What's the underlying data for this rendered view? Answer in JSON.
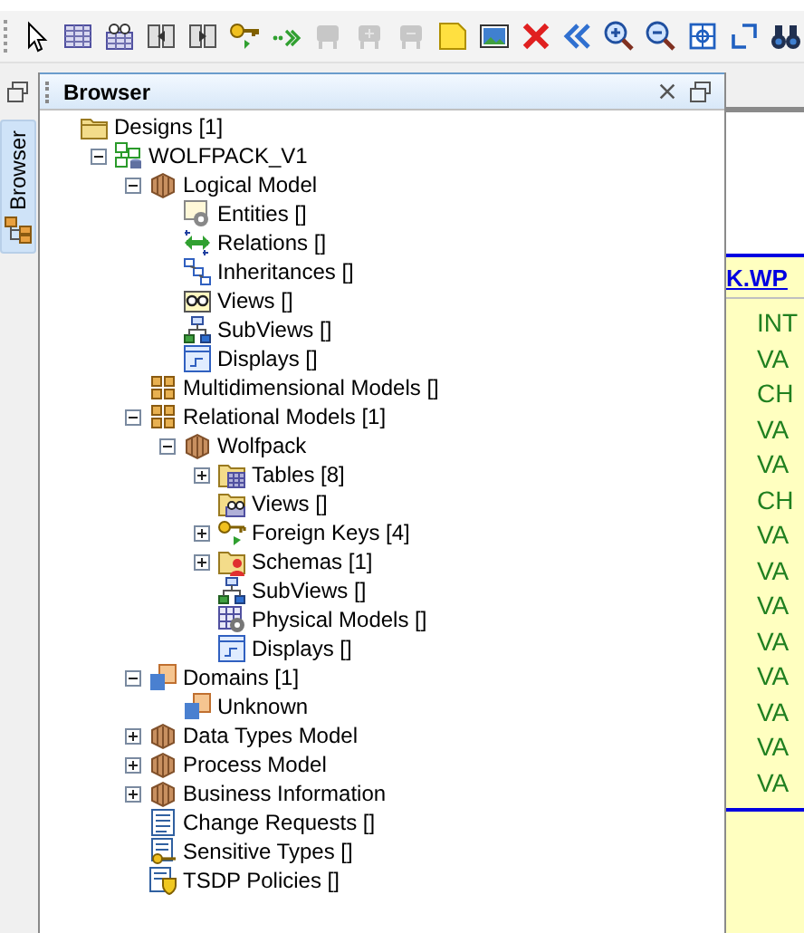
{
  "toolbar": [
    {
      "kind": "pointer",
      "disabled": false
    },
    {
      "kind": "table",
      "disabled": false
    },
    {
      "kind": "view-table",
      "disabled": false
    },
    {
      "kind": "split",
      "disabled": false
    },
    {
      "kind": "merge",
      "disabled": false
    },
    {
      "kind": "key",
      "disabled": false
    },
    {
      "kind": "arrow-dots",
      "disabled": false
    },
    {
      "kind": "box",
      "disabled": true
    },
    {
      "kind": "box-plus",
      "disabled": true
    },
    {
      "kind": "box-minus",
      "disabled": true
    },
    {
      "kind": "note",
      "disabled": false
    },
    {
      "kind": "image",
      "disabled": false
    },
    {
      "kind": "delete",
      "disabled": false
    },
    {
      "kind": "back",
      "disabled": false
    },
    {
      "kind": "zoom-in",
      "disabled": false
    },
    {
      "kind": "zoom-out",
      "disabled": false
    },
    {
      "kind": "fit",
      "disabled": false
    },
    {
      "kind": "restore",
      "disabled": false
    },
    {
      "kind": "binoculars",
      "disabled": false
    }
  ],
  "side_tab": {
    "label": "Browser",
    "selected": true
  },
  "panel": {
    "title": "Browser"
  },
  "tree": [
    {
      "label": "Designs [1]",
      "kind": "folder",
      "children": [
        {
          "label": "WOLFPACK_V1",
          "kind": "design",
          "expanded": true,
          "children": [
            {
              "label": "Logical Model",
              "kind": "cube",
              "expanded": true,
              "children": [
                {
                  "label": "Entities []",
                  "kind": "entity"
                },
                {
                  "label": "Relations []",
                  "kind": "relation"
                },
                {
                  "label": "Inheritances []",
                  "kind": "hierarchy"
                },
                {
                  "label": "Views []",
                  "kind": "glasses"
                },
                {
                  "label": "SubViews []",
                  "kind": "subview"
                },
                {
                  "label": "Displays []",
                  "kind": "display"
                }
              ]
            },
            {
              "label": "Multidimensional Models []",
              "kind": "grid"
            },
            {
              "label": "Relational Models [1]",
              "kind": "grid",
              "expanded": true,
              "children": [
                {
                  "label": "Wolfpack",
                  "kind": "cube",
                  "expanded": true,
                  "children": [
                    {
                      "label": "Tables [8]",
                      "kind": "table-folder",
                      "expanded": false
                    },
                    {
                      "label": "Views []",
                      "kind": "view-folder"
                    },
                    {
                      "label": "Foreign Keys [4]",
                      "kind": "key",
                      "expanded": false
                    },
                    {
                      "label": "Schemas [1]",
                      "kind": "schema-folder",
                      "expanded": false
                    },
                    {
                      "label": "SubViews []",
                      "kind": "subview"
                    },
                    {
                      "label": "Physical Models []",
                      "kind": "physical"
                    },
                    {
                      "label": "Displays []",
                      "kind": "display"
                    }
                  ]
                }
              ]
            },
            {
              "label": "Domains [1]",
              "kind": "domain",
              "expanded": true,
              "children": [
                {
                  "label": "Unknown",
                  "kind": "domain"
                }
              ]
            },
            {
              "label": "Data Types Model",
              "kind": "cube",
              "expanded": false
            },
            {
              "label": "Process Model",
              "kind": "cube",
              "expanded": false
            },
            {
              "label": "Business Information",
              "kind": "cube",
              "expanded": false
            },
            {
              "label": "Change Requests []",
              "kind": "list"
            },
            {
              "label": "Sensitive Types []",
              "kind": "key-doc"
            },
            {
              "label": "TSDP Policies []",
              "kind": "shield-doc"
            }
          ]
        }
      ]
    }
  ],
  "diagram": {
    "table_title": "K.WP",
    "column_types": [
      "INT",
      "VA",
      "CH",
      "VA",
      "VA",
      "CH",
      "VA",
      "VA",
      "VA",
      "VA",
      "VA",
      "VA",
      "VA",
      "VA"
    ]
  }
}
